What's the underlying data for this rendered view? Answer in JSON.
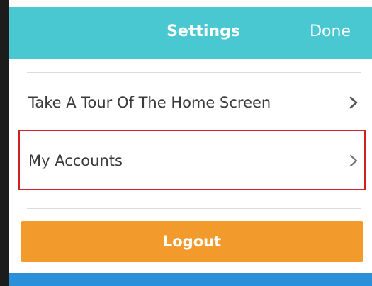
{
  "header": {
    "title": "Settings",
    "done_label": "Done",
    "background_color": "#4ac8d2"
  },
  "menu": {
    "items": [
      {
        "label": "Take A Tour Of The Home Screen",
        "icon": "chevron-right-icon"
      },
      {
        "label": "My Accounts",
        "icon": "chevron-right-icon",
        "highlighted": true
      }
    ]
  },
  "logout": {
    "label": "Logout",
    "color": "#f39a2c"
  },
  "highlight_color": "#d11f26",
  "bottom_bar_color": "#2b8fd9"
}
